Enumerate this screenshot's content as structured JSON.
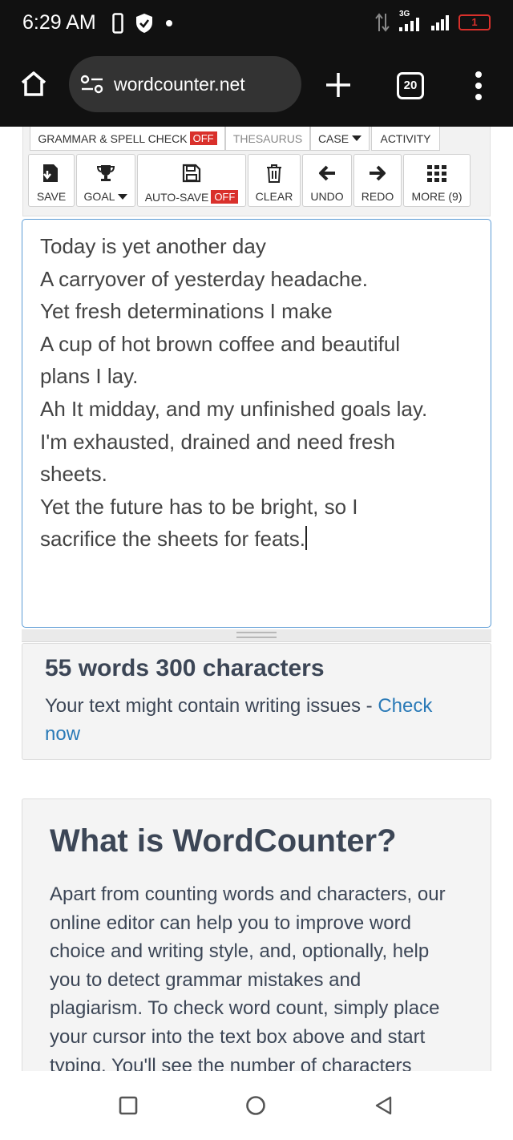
{
  "status_bar": {
    "time": "6:29 AM",
    "network_label": "3G",
    "battery_label": "1",
    "battery_color": "#d9302b"
  },
  "browser": {
    "url": "wordcounter.net",
    "tab_count": "20",
    "icons": [
      "home-icon",
      "site-settings-icon",
      "plus-icon",
      "tabs-icon",
      "more-vert-icon"
    ]
  },
  "toolbar": {
    "tabs": {
      "grammar": "GRAMMAR & SPELL CHECK",
      "grammar_state": "OFF",
      "thesaurus": "THESAURUS",
      "case": "CASE",
      "activity": "ACTIVITY"
    },
    "buttons": {
      "save": "SAVE",
      "goal": "GOAL",
      "autosave": "AUTO-SAVE",
      "autosave_state": "OFF",
      "clear": "CLEAR",
      "undo": "UNDO",
      "redo": "REDO",
      "more": "MORE (9)"
    }
  },
  "editor": {
    "lines": [
      "Today is yet another day",
      "A carryover of yesterday headache.",
      "Yet fresh determinations I make",
      "A cup of hot brown coffee and beautiful",
      "plans I lay.",
      "",
      "Ah It midday, and my unfinished goals lay.",
      "I'm exhausted, drained and need fresh",
      "sheets.",
      "Yet the future has to be bright, so I",
      "sacrifice the sheets for feats."
    ]
  },
  "stats": {
    "count": "55 words 300 characters",
    "message": "Your text might contain writing issues - ",
    "link": "Check now"
  },
  "info": {
    "title": "What is WordCounter?",
    "lines": [
      "Apart from counting words and characters, our",
      "online editor can help you to improve word",
      "choice and writing style, and, optionally, help",
      "you to detect grammar mistakes and",
      "plagiarism. To check word count, simply place",
      "your cursor into the text box above and start",
      "typing. You'll see the number of characters"
    ]
  },
  "colors": {
    "accent_link": "#2a7ab7",
    "off_badge": "#d9302b",
    "editor_border": "#5b9bd5",
    "heading_text": "#3c4656"
  }
}
